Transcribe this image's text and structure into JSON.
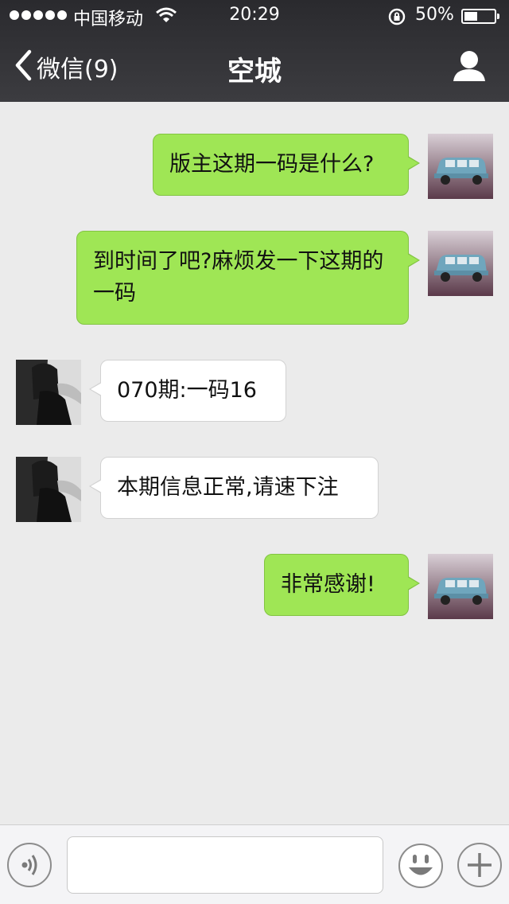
{
  "status_bar": {
    "carrier": "中国移动",
    "time": "20:29",
    "battery_percent": "50%",
    "battery_level": 0.5,
    "icons": [
      "signal-dots-icon",
      "wifi-icon",
      "rotation-lock-icon",
      "battery-icon"
    ]
  },
  "nav": {
    "back_label": "微信(9)",
    "title": "空城",
    "back_icon": "chevron-left-icon",
    "profile_icon": "person-icon"
  },
  "messages": [
    {
      "sender": "me",
      "text": "版主这期一码是什么?",
      "avatar": "car-avatar"
    },
    {
      "sender": "me",
      "text": "到时间了吧?麻烦发一下这期的一码",
      "avatar": "car-avatar"
    },
    {
      "sender": "other",
      "text": "070期:一码16",
      "avatar": "woman-avatar"
    },
    {
      "sender": "other",
      "text": "本期信息正常,请速下注",
      "avatar": "woman-avatar"
    },
    {
      "sender": "me",
      "text": "非常感谢!",
      "avatar": "car-avatar"
    }
  ],
  "input_bar": {
    "message_value": "",
    "icons": [
      "voice-icon",
      "emoji-icon",
      "plus-icon"
    ]
  },
  "colors": {
    "nav_background": "#333337",
    "chat_background": "#ebebeb",
    "my_bubble": "#9fe655",
    "other_bubble": "#ffffff"
  }
}
